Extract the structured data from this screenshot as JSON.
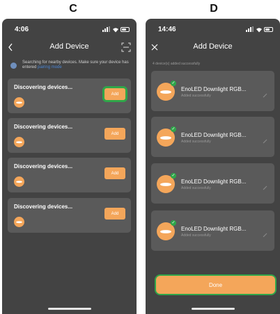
{
  "letters": {
    "left": "C",
    "right": "D"
  },
  "colors": {
    "background": "#434343",
    "card": "#5a5a5a",
    "accent": "#f4a65a",
    "highlight": "#2fa64a",
    "link": "#4a86d6"
  },
  "screen_c": {
    "status_time": "4:06",
    "title": "Add Device",
    "left_icon": "back-chevron-icon",
    "right_icon": "scan-icon",
    "search_hint": "Searching for nearby devices. Make sure your device has entered",
    "search_hint_link": "pairing mode",
    "cards": [
      {
        "title": "Discovering devices...",
        "button": "Add",
        "highlighted": true
      },
      {
        "title": "Discovering devices...",
        "button": "Add",
        "highlighted": false
      },
      {
        "title": "Discovering devices...",
        "button": "Add",
        "highlighted": false
      },
      {
        "title": "Discovering devices...",
        "button": "Add",
        "highlighted": false
      }
    ]
  },
  "screen_d": {
    "status_time": "14:46",
    "title": "Add Device",
    "left_icon": "close-icon",
    "added_caption": "4 device(s) added successfully",
    "devices": [
      {
        "name": "EnoLED Downlight RGB...",
        "status": "Added successfully"
      },
      {
        "name": "EnoLED Downlight RGB...",
        "status": "Added successfully"
      },
      {
        "name": "EnoLED Downlight RGB...",
        "status": "Added successfully"
      },
      {
        "name": "EnoLED Downlight RGB...",
        "status": "Added successfully"
      }
    ],
    "done_button": "Done"
  }
}
